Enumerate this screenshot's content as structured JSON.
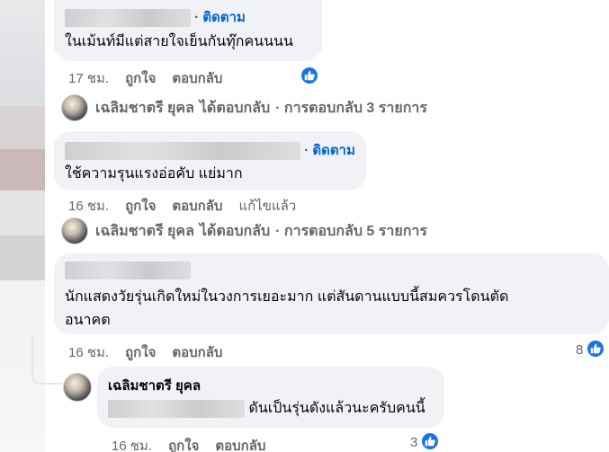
{
  "comments": [
    {
      "follow": "· ติดตาม",
      "text": "ในเม้นท์มีแต่สายใจเย็นกันทุ๊กคนนนน",
      "time": "17 ชม.",
      "like": "ถูกใจ",
      "reply": "ตอบกลับ",
      "replies_summary": {
        "author": "เฉลิมชาตรี ยุคล",
        "action": "ได้ตอบกลับ",
        "count_text": "· การตอบกลับ 3 รายการ"
      }
    },
    {
      "follow": "· ติดตาม",
      "text": "ใช้ความรุนแรงอ่อคับ แย่มาก",
      "time": "16 ชม.",
      "like": "ถูกใจ",
      "reply": "ตอบกลับ",
      "edited": "แก้ไขแล้ว",
      "replies_summary": {
        "author": "เฉลิมชาตรี ยุคล",
        "action": "ได้ตอบกลับ",
        "count_text": "· การตอบกลับ 5 รายการ"
      }
    },
    {
      "text_line1": "นักแสดงวัยรุ่นเกิดใหม่ในวงการเยอะมาก แต่สันดานแบบนี้สมควรโดนตัด",
      "text_line2": "อนาคต",
      "time": "16 ชม.",
      "like": "ถูกใจ",
      "reply": "ตอบกลับ",
      "reaction_count": "8"
    }
  ],
  "reply": {
    "author": "เฉลิมชาตรี ยุคล",
    "text": "ดันเป็นรุ่นดังแล้วนะครับคนนี้",
    "time": "16 ชม.",
    "like": "ถูกใจ",
    "reply": "ตอบกลับ",
    "reaction_count": "3"
  },
  "colors": {
    "accent": "#0064d1",
    "like_badge": "#1b74e4",
    "bubble": "#f0f2f5",
    "meta": "#65676b"
  }
}
